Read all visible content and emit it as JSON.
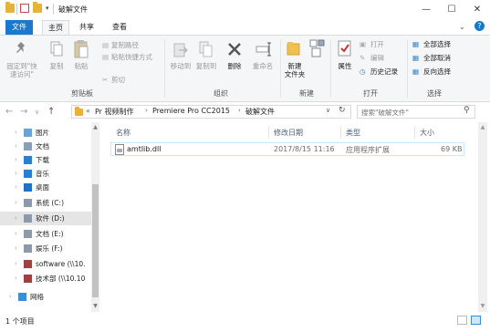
{
  "title": "破解文件",
  "window": {
    "minimize": "—",
    "maximize": "☐",
    "close": "✕",
    "help": "?"
  },
  "tabs": [
    "文件",
    "主页",
    "共享",
    "查看"
  ],
  "ribbon": {
    "clipboard": {
      "pin": "固定到\"快\n速访问\"",
      "copy": "复制",
      "paste": "粘贴",
      "cut": "剪切",
      "copy_path": "复制路径",
      "paste_shortcut": "粘贴快捷方式",
      "label": "剪贴板"
    },
    "organize": {
      "move_to": "移动到",
      "copy_to": "复制到",
      "delete": "删除",
      "rename": "重命名",
      "label": "组织"
    },
    "new": {
      "new_folder": "新建\n文件夹",
      "label": "新建"
    },
    "open": {
      "properties": "属性",
      "open": "打开",
      "edit": "编辑",
      "history": "历史记录",
      "label": "打开"
    },
    "select": {
      "select_all": "全部选择",
      "select_none": "全部取消",
      "invert": "反向选择",
      "label": "选择"
    }
  },
  "address": {
    "prefix": "«",
    "crumbs": [
      "Pr 视频制作",
      "Premiere Pro CC2015",
      "破解文件"
    ],
    "search_placeholder": "搜索\"破解文件\""
  },
  "nav": [
    {
      "label": "图片",
      "icon": "pictures-icon"
    },
    {
      "label": "文档",
      "icon": "documents-icon"
    },
    {
      "label": "下载",
      "icon": "downloads-icon"
    },
    {
      "label": "音乐",
      "icon": "music-icon"
    },
    {
      "label": "桌面",
      "icon": "desktop-icon"
    },
    {
      "label": "系统 (C:)",
      "icon": "drive-icon"
    },
    {
      "label": "软件 (D:)",
      "icon": "drive-icon"
    },
    {
      "label": "文档 (E:)",
      "icon": "drive-icon"
    },
    {
      "label": "娱乐 (F:)",
      "icon": "drive-icon"
    },
    {
      "label": "software (\\\\10.",
      "icon": "network-drive-icon"
    },
    {
      "label": "技术部 (\\\\10.10",
      "icon": "network-drive-icon"
    },
    {
      "label": "网络",
      "icon": "network-icon"
    }
  ],
  "columns": [
    "名称",
    "修改日期",
    "类型",
    "大小"
  ],
  "files": [
    {
      "name": "amtlib.dll",
      "modified": "2017/8/15 11:16",
      "type": "应用程序扩展",
      "size": "69 KB"
    }
  ],
  "status": {
    "count": "1 个项目"
  },
  "colors": {
    "accent": "#1979ca",
    "selection": "#cce8ff",
    "ribbon_bg": "#f5f6f7"
  }
}
